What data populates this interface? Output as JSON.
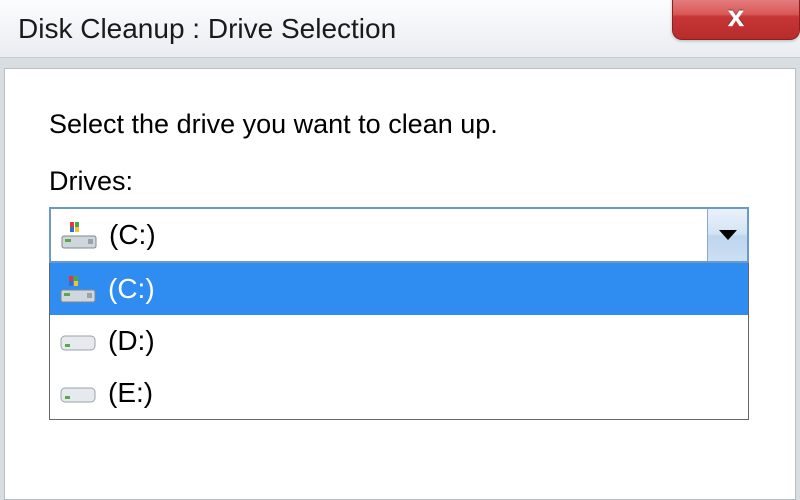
{
  "window": {
    "title": "Disk Cleanup : Drive Selection",
    "close_glyph": "x"
  },
  "instruction": "Select the drive you want to clean up.",
  "drives_label": "Drives:",
  "combo": {
    "selected": " (C:)",
    "options": [
      {
        "label": " (C:)",
        "selected": true,
        "system": true
      },
      {
        "label": " (D:)",
        "selected": false,
        "system": false
      },
      {
        "label": " (E:)",
        "selected": false,
        "system": false
      }
    ]
  }
}
